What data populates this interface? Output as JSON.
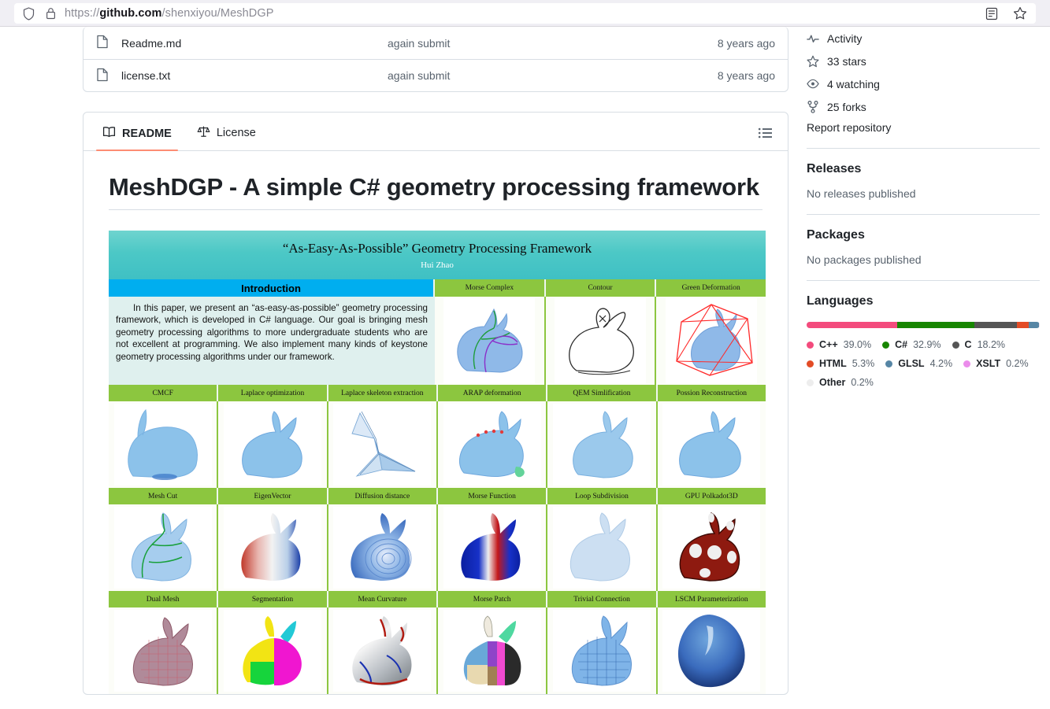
{
  "browser": {
    "url_prefix": "https://",
    "url_domain": "github.com",
    "url_path": "/shenxiyou/MeshDGP",
    "shield_icon": "shield-icon",
    "lock_icon": "lock-icon",
    "reader_icon": "reader-mode-icon",
    "bookmark_icon": "bookmark-star-icon"
  },
  "files": {
    "rows": [
      {
        "icon": "file-icon",
        "name": "Readme.md",
        "message": "again submit",
        "age": "8 years ago"
      },
      {
        "icon": "file-icon",
        "name": "license.txt",
        "message": "again submit",
        "age": "8 years ago"
      }
    ]
  },
  "readme": {
    "tabs": [
      {
        "label": "README",
        "icon": "book-icon",
        "active": true
      },
      {
        "label": "License",
        "icon": "law-scale-icon",
        "active": false
      }
    ],
    "outline_icon": "outline-list-icon",
    "heading": "MeshDGP - A simple C# geometry processing framework",
    "teaser": {
      "banner_title": "“As-Easy-As-Possible”  Geometry Processing Framework",
      "banner_author": "Hui Zhao",
      "intro_label": "Introduction",
      "abstract": "In this paper, we present an “as-easy-as-possible” geometry processing framework, which is developed in C# language. Our goal is bringing mesh geometry processing algorithms to more undergraduate students who are not excellent at programming. We also implement many kinds of keystone geometry processing algorithms under our framework.",
      "top_labels": [
        "Morse Complex",
        "Contour",
        "Green Deformation"
      ],
      "row_labels": [
        [
          "CMCF",
          "Laplace optimization",
          "Laplace skeleton extraction",
          "ARAP deformation",
          "QEM Simlification",
          "Possion Reconstruction"
        ],
        [
          "Mesh Cut",
          "EigenVector",
          "Diffusion distance",
          "Morse Function",
          "Loop Subdivision",
          "GPU Polkadot3D"
        ],
        [
          "Dual Mesh",
          "Segmentation",
          "Mean Curvature",
          "Morse Patch",
          "Trivial Connection",
          "LSCM Parameterization"
        ]
      ],
      "colors": {
        "banner_teal": "#4cc8c6",
        "intro_blue": "#00aeef",
        "label_green": "#8cc63f",
        "abstract_bg": "#dff0ee"
      }
    }
  },
  "sidebar": {
    "stats": [
      {
        "icon": "pulse-icon",
        "label": "Activity"
      },
      {
        "icon": "star-icon",
        "label": "33 stars"
      },
      {
        "icon": "eye-icon",
        "label": "4 watching"
      },
      {
        "icon": "fork-icon",
        "label": "25 forks"
      }
    ],
    "report_link": "Report repository",
    "releases": {
      "title": "Releases",
      "empty": "No releases published"
    },
    "packages": {
      "title": "Packages",
      "empty": "No packages published"
    },
    "languages": {
      "title": "Languages",
      "items": [
        {
          "name": "C++",
          "pct": "39.0%",
          "value": 39.0,
          "color": "#f34b7d"
        },
        {
          "name": "C#",
          "pct": "32.9%",
          "value": 32.9,
          "color": "#178600"
        },
        {
          "name": "C",
          "pct": "18.2%",
          "value": 18.2,
          "color": "#555555"
        },
        {
          "name": "HTML",
          "pct": "5.3%",
          "value": 5.3,
          "color": "#e34c26"
        },
        {
          "name": "GLSL",
          "pct": "4.2%",
          "value": 4.2,
          "color": "#5686a5"
        },
        {
          "name": "XSLT",
          "pct": "0.2%",
          "value": 0.2,
          "color": "#eb8ceb"
        },
        {
          "name": "Other",
          "pct": "0.2%",
          "value": 0.2,
          "color": "#ededed"
        }
      ]
    }
  }
}
